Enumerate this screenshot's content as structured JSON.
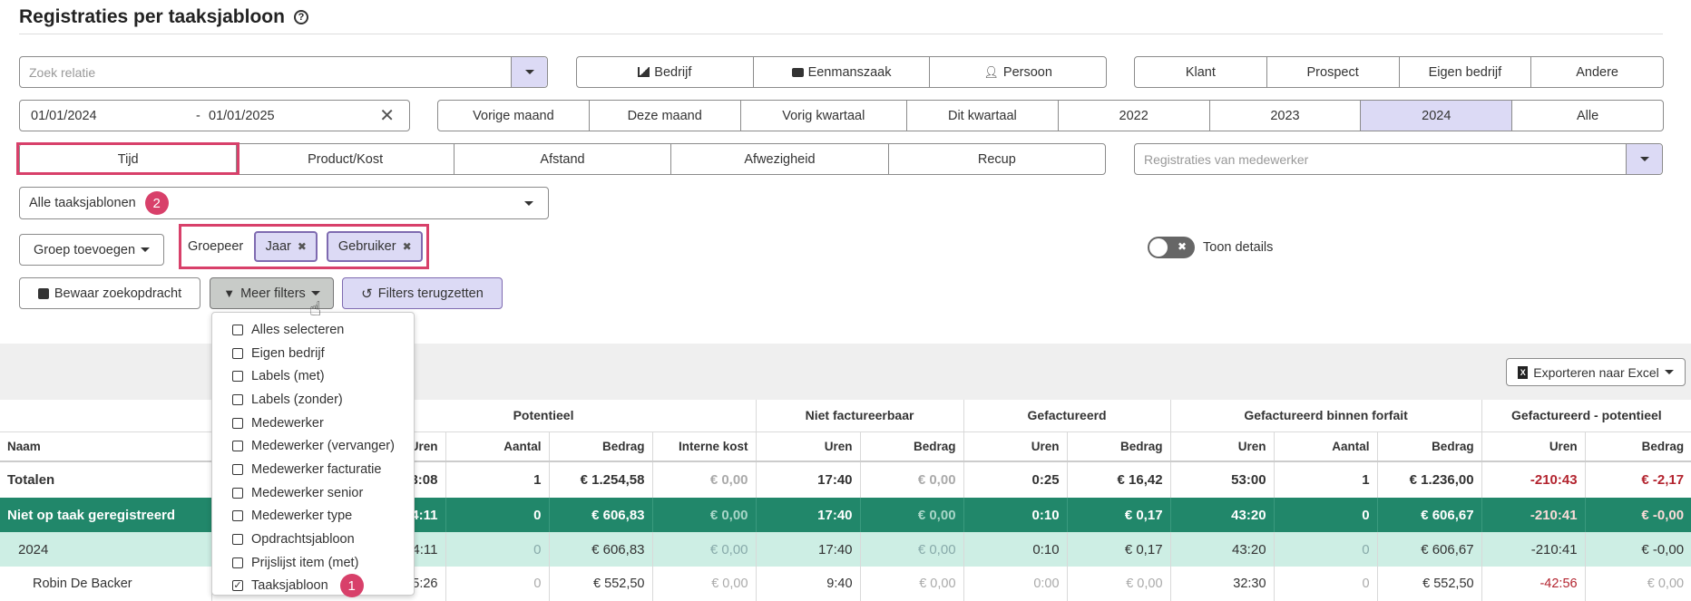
{
  "page": {
    "title": "Registraties per taaksjabloon",
    "help_icon": "question-circle-icon"
  },
  "search_relation": {
    "placeholder": "Zoek relatie"
  },
  "type_segment": [
    {
      "label": "Bedrijf",
      "icon": "factory-icon"
    },
    {
      "label": "Eenmanszaak",
      "icon": "briefcase-icon"
    },
    {
      "label": "Persoon",
      "icon": "user-icon"
    }
  ],
  "relation_segment": [
    "Klant",
    "Prospect",
    "Eigen bedrijf",
    "Andere"
  ],
  "date_range": {
    "from": "01/01/2024",
    "sep": "-",
    "to": "01/01/2025"
  },
  "period_segment": {
    "items": [
      "Vorige maand",
      "Deze maand",
      "Vorig kwartaal",
      "Dit kwartaal",
      "2022",
      "2023",
      "2024",
      "Alle"
    ],
    "active": "2024"
  },
  "kind_segment": {
    "items": [
      "Tijd",
      "Product/Kost",
      "Afstand",
      "Afwezigheid",
      "Recup"
    ],
    "active": "Tijd"
  },
  "employee_filter": {
    "placeholder": "Registraties van medewerker"
  },
  "template_select": {
    "value": "Alle taaksjablonen",
    "badge": "2"
  },
  "group_add": {
    "label": "Groep toevoegen"
  },
  "group_by": {
    "label": "Groepeer",
    "chips": [
      "Jaar",
      "Gebruiker"
    ]
  },
  "toggle_details": {
    "label": "Toon details"
  },
  "actions": {
    "save": "Bewaar zoekopdracht",
    "more_filters": "Meer filters",
    "reset": "Filters terugzetten"
  },
  "filter_menu": {
    "items": [
      {
        "label": "Alles selecteren",
        "checked": false
      },
      {
        "label": "Eigen bedrijf",
        "checked": false
      },
      {
        "label": "Labels (met)",
        "checked": false
      },
      {
        "label": "Labels (zonder)",
        "checked": false
      },
      {
        "label": "Medewerker",
        "checked": false
      },
      {
        "label": "Medewerker (vervanger)",
        "checked": false
      },
      {
        "label": "Medewerker facturatie",
        "checked": false
      },
      {
        "label": "Medewerker senior",
        "checked": false
      },
      {
        "label": "Medewerker type",
        "checked": false
      },
      {
        "label": "Opdrachtsjabloon",
        "checked": false
      },
      {
        "label": "Prijslijst item (met)",
        "checked": false
      },
      {
        "label": "Taaksjabloon",
        "checked": true
      }
    ],
    "badge": "1"
  },
  "export": {
    "label": "Exporteren naar Excel"
  },
  "table": {
    "groups": [
      "",
      "Potentieel",
      "Niet factureerbaar",
      "Gefactureerd",
      "Gefactureerd binnen forfait",
      "Gefactureerd - potentieel"
    ],
    "headers": [
      "Naam",
      "Uren",
      "Aantal",
      "Bedrag",
      "Interne kost",
      "Uren",
      "Bedrag",
      "Uren",
      "Bedrag",
      "Uren",
      "Aantal",
      "Bedrag",
      "Uren",
      "Bedrag"
    ],
    "rows": [
      {
        "kind": "tot",
        "cells": [
          "Totalen",
          "3:08",
          "1",
          "€ 1.254,58",
          "€ 0,00",
          "17:40",
          "€ 0,00",
          "0:25",
          "€ 16,42",
          "53:00",
          "1",
          "€ 1.236,00",
          "-210:43",
          "€ -2,17"
        ]
      },
      {
        "kind": "green",
        "cells": [
          "Niet op taak geregistreerd",
          "4:11",
          "0",
          "€ 606,83",
          "€ 0,00",
          "17:40",
          "€ 0,00",
          "0:10",
          "€ 0,17",
          "43:20",
          "0",
          "€ 606,67",
          "-210:41",
          "€ -0,00"
        ]
      },
      {
        "kind": "year",
        "cells": [
          "2024",
          "4:11",
          "0",
          "€ 606,83",
          "€ 0,00",
          "17:40",
          "€ 0,00",
          "0:10",
          "€ 0,17",
          "43:20",
          "0",
          "€ 606,67",
          "-210:41",
          "€ -0,00"
        ]
      },
      {
        "kind": "user",
        "cells": [
          "Robin De Backer",
          "5:26",
          "0",
          "€ 552,50",
          "€ 0,00",
          "9:40",
          "€ 0,00",
          "0:00",
          "€ 0,00",
          "32:30",
          "0",
          "€ 552,50",
          "-42:56",
          "€ 0,00"
        ]
      }
    ]
  }
}
